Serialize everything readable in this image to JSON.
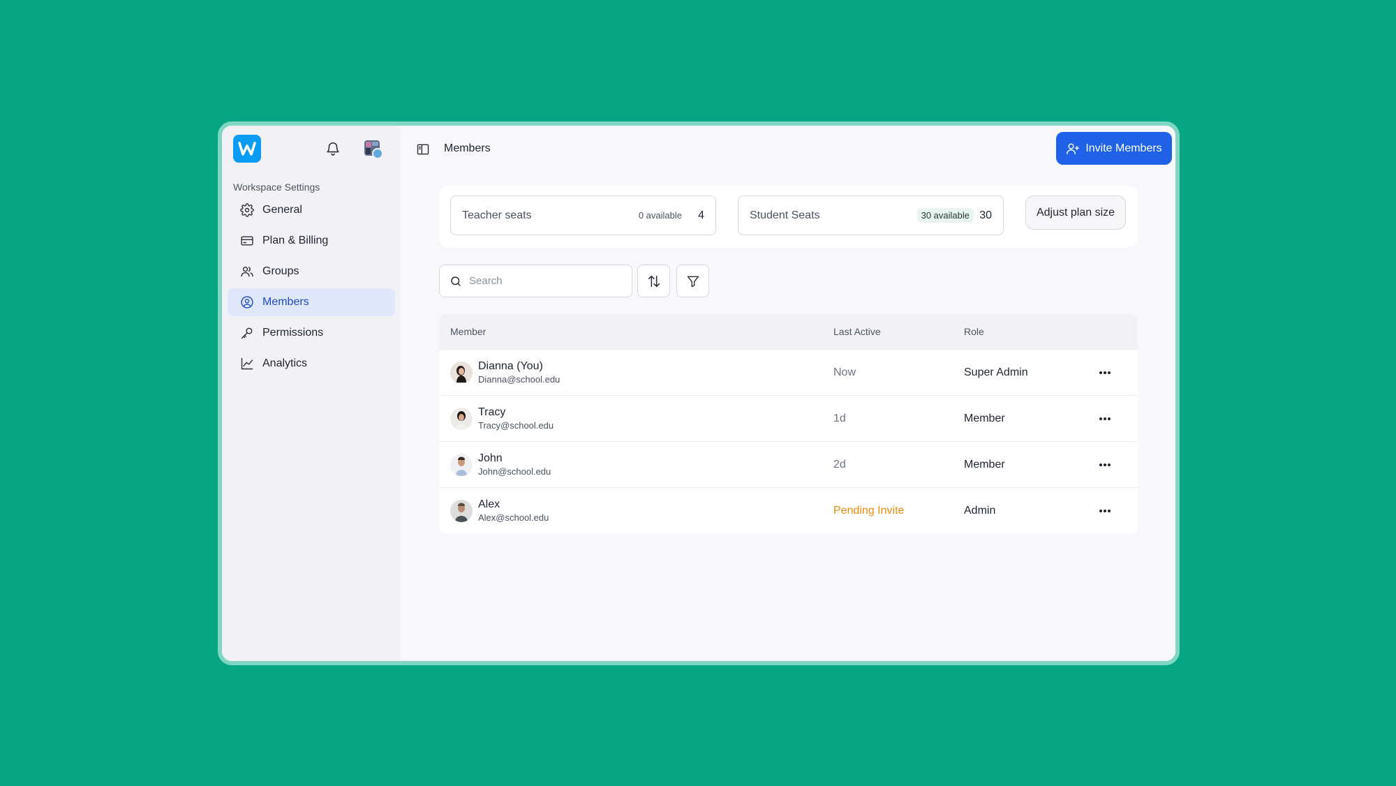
{
  "sidebar": {
    "section_title": "Workspace Settings",
    "items": [
      {
        "label": "General",
        "icon": "gear-icon"
      },
      {
        "label": "Plan & Billing",
        "icon": "credit-card-icon"
      },
      {
        "label": "Groups",
        "icon": "users-icon"
      },
      {
        "label": "Members",
        "icon": "user-circle-icon",
        "active": true
      },
      {
        "label": "Permissions",
        "icon": "key-icon"
      },
      {
        "label": "Analytics",
        "icon": "line-chart-icon"
      }
    ]
  },
  "header": {
    "title": "Members",
    "invite_label": "Invite Members"
  },
  "seats": {
    "teacher": {
      "label": "Teacher seats",
      "available": "0 available",
      "count": "4"
    },
    "student": {
      "label": "Student Seats",
      "available": "30 available",
      "count": "30"
    },
    "adjust_label": "Adjust plan size"
  },
  "search": {
    "placeholder": "Search",
    "value": ""
  },
  "table": {
    "headers": {
      "member": "Member",
      "last_active": "Last Active",
      "role": "Role"
    },
    "rows": [
      {
        "name": "Dianna (You)",
        "email": "Dianna@school.edu",
        "last_active": "Now",
        "role": "Super Admin"
      },
      {
        "name": "Tracy",
        "email": "Tracy@school.edu",
        "last_active": "1d",
        "role": "Member"
      },
      {
        "name": "John",
        "email": "John@school.edu",
        "last_active": "2d",
        "role": "Member"
      },
      {
        "name": "Alex",
        "email": "Alex@school.edu",
        "last_active": "Pending Invite",
        "role": "Admin",
        "pending": true
      }
    ]
  },
  "colors": {
    "background": "#06a684",
    "accent": "#1f62e8",
    "active_nav": "#dfe7fd",
    "pending": "#ef8a0a"
  }
}
